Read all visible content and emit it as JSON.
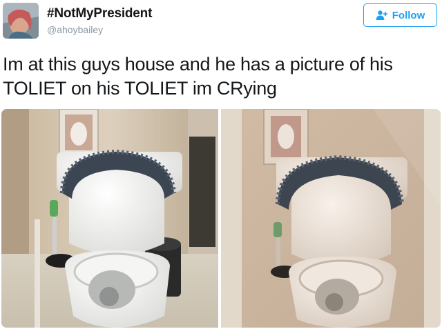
{
  "user": {
    "display_name": "#NotMyPresident",
    "handle": "@ahoybailey",
    "avatar_icon": "user-avatar"
  },
  "follow": {
    "label": "Follow",
    "icon": "add-user-icon",
    "color": "#1da1f2"
  },
  "tweet": {
    "text": "Im at this guys house and he has a picture of his TOLIET on his TOLIET im CRying"
  },
  "media": {
    "count": 2
  },
  "colors": {
    "text": "#14171a",
    "secondary": "#8899a6",
    "accent": "#1da1f2"
  }
}
